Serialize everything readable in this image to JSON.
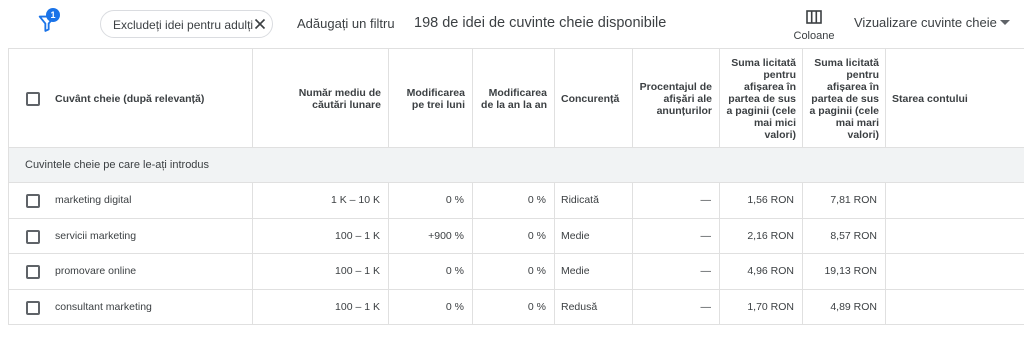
{
  "toolbar": {
    "filter_badge": "1",
    "chip_label": "Excludeți idei pentru adulți",
    "add_filter": "Adăugați un filtru",
    "count_text": "198 de idei de cuvinte cheie disponibile",
    "columns_label": "Coloane",
    "view_label": "Vizualizare cuvinte cheie"
  },
  "table": {
    "headers": {
      "keyword": "Cuvânt cheie (după relevanță)",
      "avg_searches": "Număr mediu de căutări lunare",
      "three_month": "Modificarea pe trei luni",
      "yoy": "Modificarea de la an la an",
      "competition": "Concurență",
      "impression_share": "Procentajul de afișări ale anunțurilor",
      "bid_low": "Suma licitată pentru afișarea în partea de sus a paginii (cele mai mici valori)",
      "bid_high": "Suma licitată pentru afișarea în partea de sus a paginii (cele mai mari valori)",
      "account_status": "Starea contului"
    },
    "section_label": "Cuvintele cheie pe care le-ați introdus",
    "rows": [
      {
        "keyword": "marketing digital",
        "avg_searches": "1 K – 10 K",
        "three_month": "0 %",
        "yoy": "0 %",
        "competition": "Ridicată",
        "impression_share": "—",
        "bid_low": "1,56 RON",
        "bid_high": "7,81 RON",
        "account_status": ""
      },
      {
        "keyword": "servicii marketing",
        "avg_searches": "100 – 1 K",
        "three_month": "+900 %",
        "yoy": "0 %",
        "competition": "Medie",
        "impression_share": "—",
        "bid_low": "2,16 RON",
        "bid_high": "8,57 RON",
        "account_status": ""
      },
      {
        "keyword": "promovare online",
        "avg_searches": "100 – 1 K",
        "three_month": "0 %",
        "yoy": "0 %",
        "competition": "Medie",
        "impression_share": "—",
        "bid_low": "4,96 RON",
        "bid_high": "19,13 RON",
        "account_status": ""
      },
      {
        "keyword": "consultant marketing",
        "avg_searches": "100 – 1 K",
        "three_month": "0 %",
        "yoy": "0 %",
        "competition": "Redusă",
        "impression_share": "—",
        "bid_low": "1,70 RON",
        "bid_high": "4,89 RON",
        "account_status": ""
      }
    ]
  },
  "icons": {
    "filter": "filter-icon",
    "close": "close-icon",
    "columns": "columns-icon",
    "caret": "caret-down-icon"
  },
  "colors": {
    "accent": "#1a73e8",
    "section_bg": "#f1f3f4",
    "border": "#e0e0e0"
  }
}
